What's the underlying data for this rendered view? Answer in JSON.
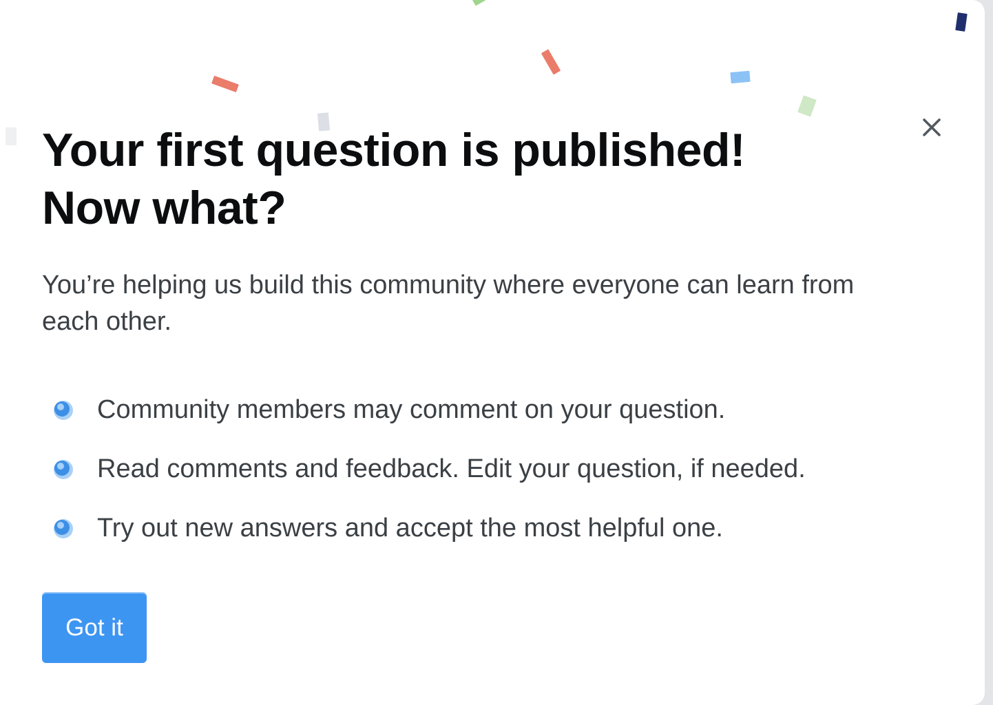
{
  "dialog": {
    "title_line1": "Your first question is published!",
    "title_line2": "Now what?",
    "intro": "You’re helping us build this community where everyone can learn from each other.",
    "steps": [
      "Community members may comment on your question.",
      "Read comments and feedback. Edit your question, if needed.",
      "Try out new answers and accept the most helpful one."
    ],
    "primary_button": "Got it",
    "close_icon": "close-icon",
    "bullet_icon": "blue-orb-icon"
  },
  "colors": {
    "button": "#3d95f2",
    "title": "#0c0d0e",
    "body_text": "#3b4045",
    "close_icon": "#525960"
  }
}
